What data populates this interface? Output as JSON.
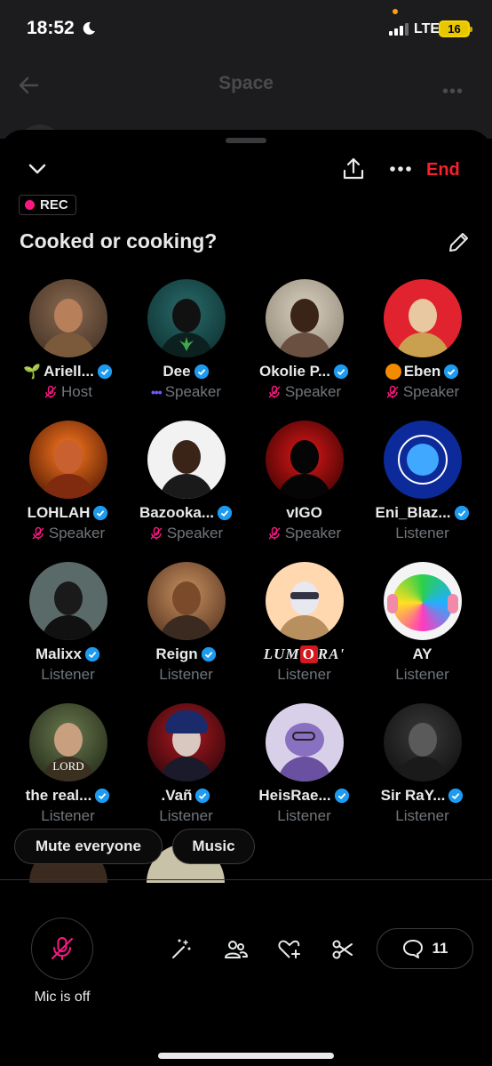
{
  "status_bar": {
    "time": "18:52",
    "network": "LTE",
    "battery": "16"
  },
  "background_header": {
    "title": "Space"
  },
  "sheet": {
    "end_label": "End",
    "rec_label": "REC",
    "title": "Cooked or cooking?"
  },
  "participants": [
    {
      "name": "Ariell...",
      "prefix": "🌱",
      "role": "Host",
      "role_icon": "mic-off-icon",
      "verified": true
    },
    {
      "name": "Dee",
      "role": "Speaker",
      "role_icon": "speaking-dots-icon",
      "verified": true
    },
    {
      "name": "Okolie P...",
      "role": "Speaker",
      "role_icon": "mic-off-icon",
      "verified": true
    },
    {
      "name": "Eben",
      "prefix": "orange-circle",
      "role": "Speaker",
      "role_icon": "mic-off-icon",
      "verified": true
    },
    {
      "name": "LOHLAH",
      "role": "Speaker",
      "role_icon": "mic-off-icon",
      "verified": true
    },
    {
      "name": "Bazooka...",
      "role": "Speaker",
      "role_icon": "mic-off-icon",
      "verified": true
    },
    {
      "name": "vIGO",
      "role": "Speaker",
      "role_icon": "mic-off-icon",
      "verified": false
    },
    {
      "name": "Eni_Blaz...",
      "role": "Listener",
      "verified": true
    },
    {
      "name": "Malixx",
      "role": "Listener",
      "verified": true
    },
    {
      "name": "Reign",
      "role": "Listener",
      "verified": true
    },
    {
      "name_parts": [
        "LUM",
        "O",
        "RA'"
      ],
      "role": "Listener",
      "verified": false
    },
    {
      "name": "AY",
      "role": "Listener",
      "verified": false
    },
    {
      "name": "the real...",
      "role": "Listener",
      "verified": true
    },
    {
      "name": ".Vañ",
      "role": "Listener",
      "verified": true
    },
    {
      "name": "HeisRae...",
      "role": "Listener",
      "verified": true
    },
    {
      "name": "Sir RaY...",
      "role": "Listener",
      "verified": true
    }
  ],
  "pills": {
    "mute_everyone": "Mute everyone",
    "music": "Music"
  },
  "controls": {
    "mic_label": "Mic is off",
    "comment_count": "11",
    "icons": [
      "magic-wand-icon",
      "people-icon",
      "heart-plus-icon",
      "scissors-icon",
      "comment-icon"
    ]
  },
  "colors": {
    "accent_red": "#f4212e",
    "rec_pink": "#f91880",
    "verified_blue": "#1d9bf0",
    "muted": "#71767b"
  }
}
